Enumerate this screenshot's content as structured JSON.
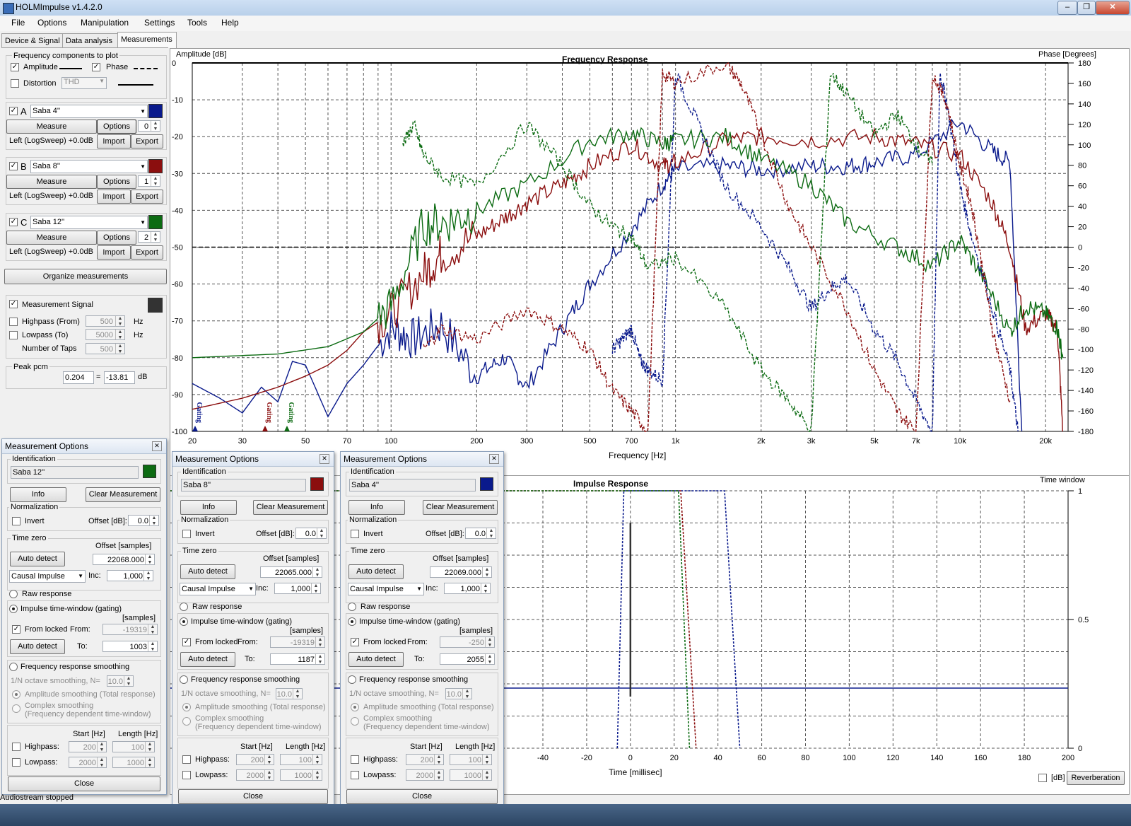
{
  "window": {
    "title": "HOLMImpulse  v1.4.2.0",
    "min": "–",
    "max": "❐",
    "close": "✕"
  },
  "menu": [
    "File",
    "Options",
    "Manipulation",
    "Settings",
    "Tools",
    "Help"
  ],
  "tabs": [
    "Device & Signal",
    "Data analysis",
    "Measurements"
  ],
  "freq_components": {
    "title": "Frequency components to plot",
    "amplitude_label": "Amplitude",
    "amplitude_checked": true,
    "phase_label": "Phase",
    "phase_checked": true,
    "distortion_label": "Distortion",
    "distortion_checked": false,
    "distortion_select": "THD"
  },
  "measurements": [
    {
      "letter": "A",
      "name": "Saba 4''",
      "color": "#0a1a8c",
      "measure": "Measure",
      "options": "Options",
      "index": "0",
      "info": "Left (LogSweep) +0.0dB",
      "import": "Import",
      "export": "Export"
    },
    {
      "letter": "B",
      "name": "Saba 8''",
      "color": "#8b0e0e",
      "measure": "Measure",
      "options": "Options",
      "index": "1",
      "info": "Left (LogSweep) +0.0dB",
      "import": "Import",
      "export": "Export"
    },
    {
      "letter": "C",
      "name": "Saba 12''",
      "color": "#0c6b12",
      "measure": "Measure",
      "options": "Options",
      "index": "2",
      "info": "Left (LogSweep) +0.0dB",
      "import": "Import",
      "export": "Export"
    }
  ],
  "organize": "Organize measurements",
  "signal": {
    "label": "Measurement Signal",
    "color": "#333333",
    "highpass_label": "Highpass (From)",
    "highpass_value": "500",
    "hz": "Hz",
    "lowpass_label": "Lowpass (To)",
    "lowpass_value": "5000",
    "taps_label": "Number of Taps",
    "taps_value": "500"
  },
  "peak": {
    "label": "Peak pcm",
    "value": "0.204",
    "eq": "=",
    "db_value": "-13.81",
    "unit": "dB"
  },
  "freq_plot": {
    "title": "Frequency Response",
    "ylabel": "Amplitude [dB]",
    "y2label": "Phase [Degrees]",
    "xlabel": "Frequency [Hz]",
    "y_ticks": [
      "0",
      "-10",
      "-20",
      "-30",
      "-40",
      "-50",
      "-60",
      "-70",
      "-80",
      "-90",
      "-100"
    ],
    "y2_ticks": [
      "180",
      "160",
      "140",
      "120",
      "100",
      "80",
      "60",
      "40",
      "20",
      "0",
      "-20",
      "-40",
      "-60",
      "-80",
      "-100",
      "-120",
      "-140",
      "-160",
      "-180"
    ],
    "x_ticks": [
      "20",
      "30",
      "50",
      "70",
      "100",
      "200",
      "300",
      "500",
      "700",
      "1k",
      "2k",
      "3k",
      "5k",
      "7k",
      "10k",
      "20k"
    ],
    "gating_label": "Gating"
  },
  "impulse_plot": {
    "title": "Impulse Response",
    "time_window_label": "Time window",
    "xlabel": "Time [millisec]",
    "x_ticks": [
      "-40",
      "-20",
      "0",
      "20",
      "40",
      "60",
      "80",
      "100",
      "120",
      "140",
      "160",
      "180",
      "200"
    ],
    "y2_ticks": [
      "1",
      "0.5",
      "0"
    ],
    "db_label": "[dB]",
    "reverb_button": "Reverberation"
  },
  "chart_data": [
    {
      "type": "line",
      "title": "Frequency Response",
      "xlabel": "Frequency [Hz]",
      "ylabel": "Amplitude [dB]",
      "y2label": "Phase [Degrees]",
      "x_scale": "log",
      "xlim": [
        20,
        24000
      ],
      "ylim": [
        -100,
        0
      ],
      "y2lim": [
        -180,
        180
      ],
      "grid": true,
      "series": [
        {
          "name": "Saba 4''",
          "style": "amplitude",
          "color": "#0a1a8c",
          "x": [
            20,
            25,
            30,
            35,
            40,
            45,
            50,
            60,
            70,
            80,
            100,
            120,
            150,
            200,
            250,
            300,
            400,
            500,
            700,
            900,
            1000,
            1500,
            2000,
            3000,
            4000,
            5000,
            7000,
            10000,
            13000,
            15000,
            16500
          ],
          "y": [
            -87,
            -91,
            -95,
            -88,
            -92,
            -81,
            -82,
            -96,
            -87,
            -82,
            -72,
            -75,
            -71,
            -85,
            -80,
            -88,
            -72,
            -60,
            -45,
            -33,
            -29,
            -28,
            -29,
            -28,
            -28,
            -27,
            -25,
            -16,
            -24,
            -27,
            -100
          ]
        },
        {
          "name": "Saba 8''",
          "style": "amplitude",
          "color": "#8b0e0e",
          "x": [
            20,
            30,
            40,
            50,
            60,
            70,
            80,
            100,
            130,
            150,
            200,
            250,
            300,
            400,
            500,
            700,
            900,
            1000,
            1500,
            2000,
            3000,
            5000,
            7000,
            10000,
            13000,
            15000,
            17000,
            20000,
            22000,
            23000
          ],
          "y": [
            -94,
            -91,
            -88,
            -85,
            -82,
            -78,
            -73,
            -68,
            -57,
            -52,
            -47,
            -42,
            -38,
            -33,
            -28,
            -22,
            -28,
            -27,
            -21,
            -20,
            -21,
            -20,
            -22,
            -25,
            -38,
            -50,
            -72,
            -68,
            -72,
            -100
          ]
        },
        {
          "name": "Saba 12''",
          "style": "amplitude",
          "color": "#0c6b12",
          "x": [
            20,
            40,
            60,
            80,
            100,
            130,
            160,
            200,
            300,
            500,
            700,
            900,
            1000,
            1500,
            2000,
            3000,
            4000,
            6000,
            8000,
            10000,
            12000,
            15000,
            17000,
            20000,
            22000,
            23000
          ],
          "y": [
            -80,
            -79,
            -77,
            -73,
            -66,
            -44,
            -43,
            -40,
            -33,
            -21,
            -19,
            -22,
            -21,
            -20,
            -26,
            -33,
            -43,
            -50,
            -55,
            -48,
            -58,
            -73,
            -66,
            -68,
            -72,
            -80
          ]
        },
        {
          "name": "Saba 4''",
          "style": "phase",
          "color": "#0a1a8c",
          "x": [
            600,
            650,
            700,
            750,
            800,
            900,
            1000,
            1200,
            1500,
            2000,
            2500,
            3000,
            3500,
            4000,
            5000,
            6000,
            7000,
            8000,
            8500,
            9000,
            10000,
            11000,
            13000,
            15000,
            16000
          ],
          "y": [
            -100,
            -90,
            -80,
            -110,
            -120,
            -130,
            170,
            120,
            60,
            20,
            -20,
            -60,
            -40,
            -30,
            -80,
            -110,
            -150,
            -180,
            170,
            140,
            60,
            10,
            -60,
            -120,
            -180
          ]
        },
        {
          "name": "Saba 8''",
          "style": "phase",
          "color": "#8b0e0e",
          "x": [
            130,
            150,
            200,
            300,
            400,
            500,
            600,
            700,
            800,
            900,
            1000,
            1500,
            1700,
            2000,
            2500,
            3000,
            4000,
            5000,
            6000,
            7000,
            8000,
            9000,
            10000,
            11000,
            12000,
            13000,
            15000
          ],
          "y": [
            -100,
            -80,
            -90,
            -60,
            -80,
            -100,
            -140,
            -160,
            -180,
            170,
            160,
            180,
            160,
            110,
            40,
            0,
            -60,
            -120,
            -160,
            -180,
            170,
            140,
            80,
            40,
            -20,
            -80,
            -150
          ]
        },
        {
          "name": "Saba 12''",
          "style": "phase",
          "color": "#0c6b12",
          "x": [
            110,
            120,
            130,
            150,
            200,
            300,
            400,
            500,
            600,
            700,
            800,
            1000,
            1500,
            2000,
            2500,
            3000,
            3500,
            4000,
            5000,
            6000,
            7000,
            8000
          ],
          "y": [
            100,
            120,
            90,
            70,
            60,
            120,
            80,
            40,
            20,
            10,
            -20,
            -10,
            -60,
            -120,
            -150,
            -180,
            170,
            150,
            110,
            130,
            100,
            80
          ]
        }
      ]
    },
    {
      "type": "line",
      "title": "Impulse Response",
      "xlabel": "Time [millisec]",
      "y2label": "Time window",
      "xlim": [
        -45,
        200
      ],
      "y2lim": [
        0,
        1
      ],
      "grid": true,
      "series": [
        {
          "name": "Saba 4''",
          "style": "time-window",
          "color": "#0a1a8c",
          "x": [
            -6,
            -3,
            40,
            43,
            50
          ],
          "y": [
            0,
            1,
            1,
            1,
            0
          ]
        },
        {
          "name": "Saba 8''",
          "style": "time-window",
          "color": "#8b0e0e",
          "x": [
            -45,
            20,
            23,
            30
          ],
          "y": [
            1,
            1,
            1,
            0
          ]
        },
        {
          "name": "Saba 12''",
          "style": "time-window",
          "color": "#0c6b12",
          "x": [
            -45,
            20,
            22,
            27
          ],
          "y": [
            1,
            1,
            1,
            0
          ]
        }
      ]
    }
  ],
  "dialogs": [
    {
      "title": "Measurement Options",
      "id_label": "Identification",
      "name": "Saba 12''",
      "color": "#0c6b12",
      "info": "Info",
      "clear": "Clear Measurement",
      "normalization": "Normalization",
      "invert": "Invert",
      "offset_db_label": "Offset [dB]:",
      "offset_db": "0.0",
      "time_zero": "Time zero",
      "offset_samples_label": "Offset [samples]",
      "auto_detect": "Auto detect",
      "offset_samples": "22068.000",
      "causal": "Causal Impulse",
      "inc_label": "Inc:",
      "inc": "1,000",
      "raw": "Raw response",
      "gating": "Impulse time-window (gating)",
      "samples": "[samples]",
      "from_locked": "From locked",
      "from_label": "From:",
      "from": "-19319",
      "to_label": "To:",
      "to": "1003",
      "smoothing": "Frequency response smoothing",
      "octave_label": "1/N octave smoothing, N=",
      "octave": "10.0",
      "amp_smoothing": "Amplitude smoothing (Total response)",
      "complex_smoothing": "Complex smoothing",
      "complex_sub": "(Frequency dependent time-window)",
      "start_hz": "Start [Hz]",
      "length_hz": "Length [Hz]",
      "highpass": "Highpass:",
      "hp_start": "200",
      "hp_len": "100",
      "lowpass": "Lowpass:",
      "lp_start": "2000",
      "lp_len": "1000",
      "close": "Close"
    },
    {
      "title": "Measurement Options",
      "id_label": "Identification",
      "name": "Saba 8''",
      "color": "#8b0e0e",
      "info": "Info",
      "clear": "Clear Measurement",
      "normalization": "Normalization",
      "invert": "Invert",
      "offset_db_label": "Offset [dB]:",
      "offset_db": "0.0",
      "time_zero": "Time zero",
      "offset_samples_label": "Offset [samples]",
      "auto_detect": "Auto detect",
      "offset_samples": "22065.000",
      "causal": "Causal Impulse",
      "inc_label": "Inc:",
      "inc": "1,000",
      "raw": "Raw response",
      "gating": "Impulse time-window (gating)",
      "samples": "[samples]",
      "from_locked": "From locked",
      "from_label": "From:",
      "from": "-19319",
      "to_label": "To:",
      "to": "1187",
      "smoothing": "Frequency response smoothing",
      "octave_label": "1/N octave smoothing, N=",
      "octave": "10.0",
      "amp_smoothing": "Amplitude smoothing (Total response)",
      "complex_smoothing": "Complex smoothing",
      "complex_sub": "(Frequency dependent time-window)",
      "start_hz": "Start [Hz]",
      "length_hz": "Length [Hz]",
      "highpass": "Highpass:",
      "hp_start": "200",
      "hp_len": "100",
      "lowpass": "Lowpass:",
      "lp_start": "2000",
      "lp_len": "1000",
      "close": "Close"
    },
    {
      "title": "Measurement Options",
      "id_label": "Identification",
      "name": "Saba 4''",
      "color": "#0a1a8c",
      "info": "Info",
      "clear": "Clear Measurement",
      "normalization": "Normalization",
      "invert": "Invert",
      "offset_db_label": "Offset [dB]:",
      "offset_db": "0.0",
      "time_zero": "Time zero",
      "offset_samples_label": "Offset [samples]",
      "auto_detect": "Auto detect",
      "offset_samples": "22069.000",
      "causal": "Causal Impulse",
      "inc_label": "Inc:",
      "inc": "1,000",
      "raw": "Raw response",
      "gating": "Impulse time-window (gating)",
      "samples": "[samples]",
      "from_locked": "From locked",
      "from_label": "From:",
      "from": "-250",
      "to_label": "To:",
      "to": "2055",
      "smoothing": "Frequency response smoothing",
      "octave_label": "1/N octave smoothing, N=",
      "octave": "10.0",
      "amp_smoothing": "Amplitude smoothing (Total response)",
      "complex_smoothing": "Complex smoothing",
      "complex_sub": "(Frequency dependent time-window)",
      "start_hz": "Start [Hz]",
      "length_hz": "Length [Hz]",
      "highpass": "Highpass:",
      "hp_start": "200",
      "hp_len": "100",
      "lowpass": "Lowpass:",
      "lp_start": "2000",
      "lp_len": "1000",
      "close": "Close"
    }
  ],
  "status": "Audiostream stopped"
}
